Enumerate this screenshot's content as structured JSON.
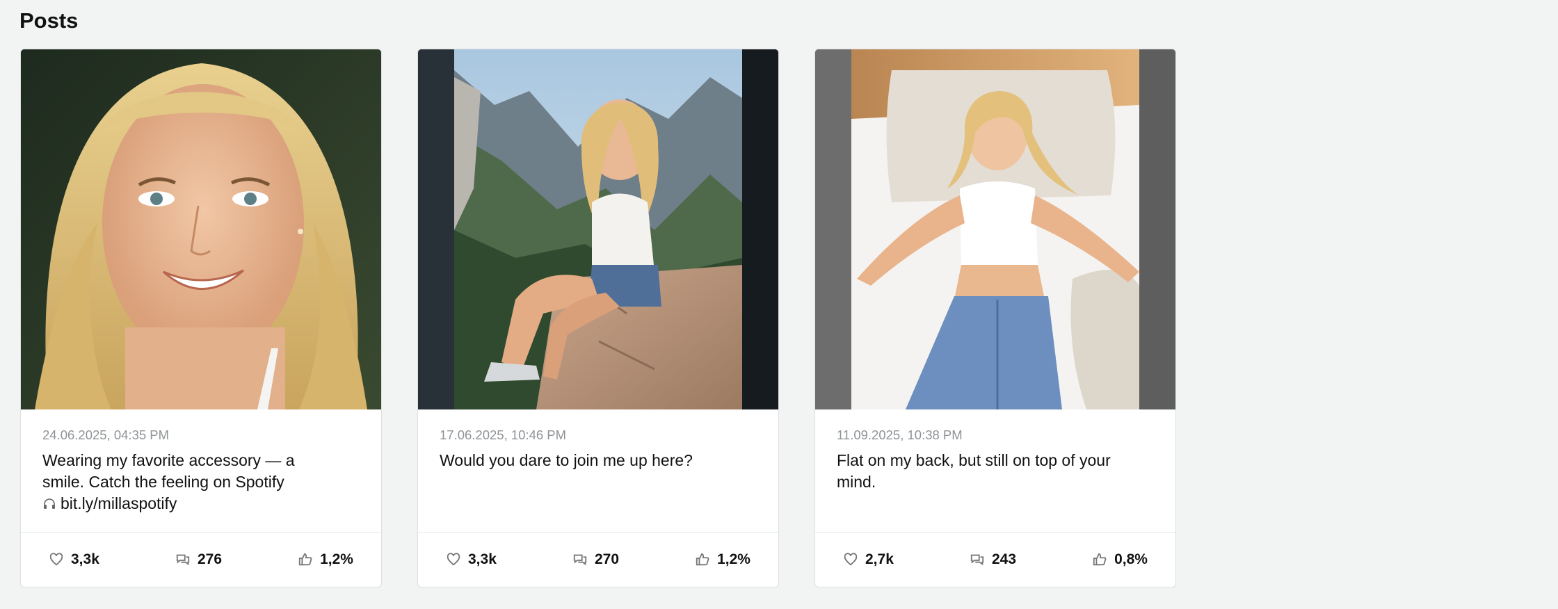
{
  "section": {
    "title": "Posts"
  },
  "posts": [
    {
      "date": "24.06.2025, 04:35 PM",
      "text_line1": "Wearing my favorite accessory — a smile. Catch the feeling on Spotify",
      "text_link": "bit.ly/millaspotify",
      "likes": "3,3k",
      "comments": "276",
      "engagement": "1,2%",
      "image": "portrait-closeup-photo"
    },
    {
      "date": "17.06.2025, 10:46 PM",
      "text": "Would you dare to join me up here?",
      "likes": "3,3k",
      "comments": "270",
      "engagement": "1,2%",
      "image": "mountain-cliff-photo"
    },
    {
      "date": "11.09.2025, 10:38 PM",
      "text": "Flat on my back, but still on top of your mind.",
      "likes": "2,7k",
      "comments": "243",
      "engagement": "0,8%",
      "image": "bed-lying-photo"
    }
  ],
  "icons": {
    "like": "heart-icon",
    "comments": "comments-icon",
    "engagement": "thumbs-up-icon",
    "headphones": "headphones-icon"
  }
}
